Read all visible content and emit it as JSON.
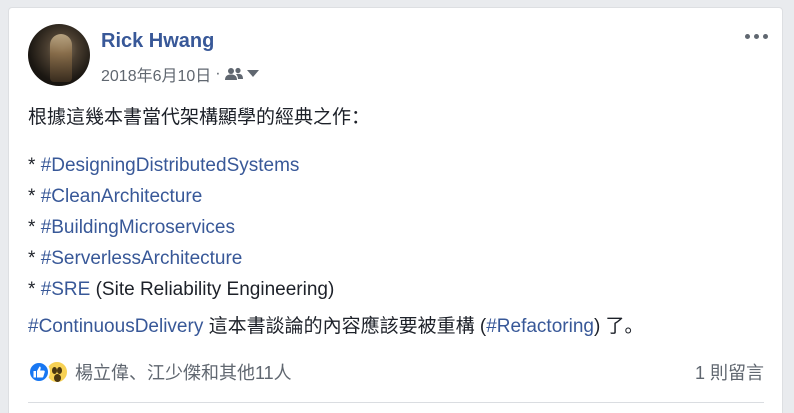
{
  "post": {
    "author": "Rick Hwang",
    "date": "2018年6月10日",
    "separator": "·",
    "audience_icon": "friends-icon",
    "intro": "根據這幾本書當代架構顯學的經典之作：",
    "list": [
      {
        "bullet": "* ",
        "tag": "#DesigningDistributedSystems",
        "suffix": ""
      },
      {
        "bullet": "* ",
        "tag": "#CleanArchitecture",
        "suffix": ""
      },
      {
        "bullet": "* ",
        "tag": "#BuildingMicroservices",
        "suffix": ""
      },
      {
        "bullet": "* ",
        "tag": "#ServerlessArchitecture",
        "suffix": ""
      },
      {
        "bullet": "* ",
        "tag": "#SRE",
        "suffix": " (Site Reliability Engineering)"
      }
    ],
    "closing": {
      "tag1": "#ContinuousDelivery",
      "text1": " 這本書談論的內容應該要被重構 (",
      "tag2": "#Refactoring",
      "text2": ") 了。"
    }
  },
  "footer": {
    "reaction_icons": [
      "like-icon",
      "wow-icon"
    ],
    "reactors": "楊立偉、江少傑和其他11人",
    "comments": "1 則留言"
  },
  "colors": {
    "link": "#385898",
    "text": "#1d2129",
    "secondary": "#606770",
    "like": "#1877f2",
    "wow": "#f7d154"
  }
}
